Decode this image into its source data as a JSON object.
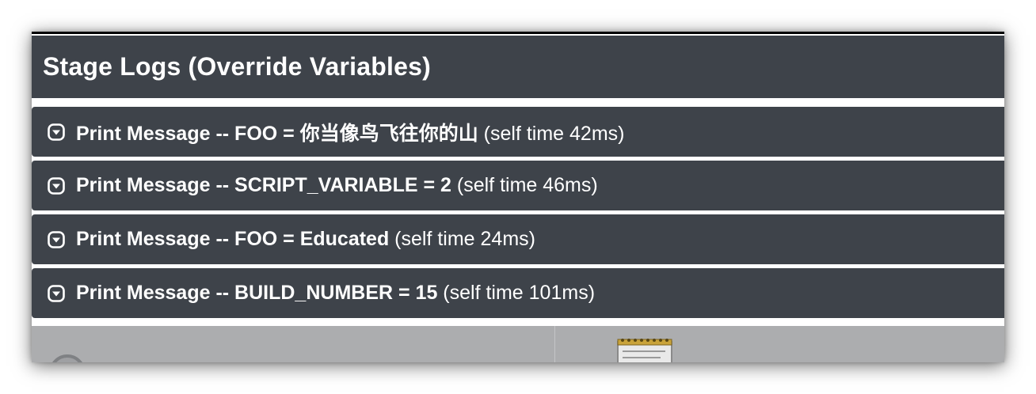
{
  "panel": {
    "title": "Stage Logs (Override Variables)"
  },
  "logs": [
    {
      "label": "Print Message -- FOO = 你当像鸟飞往你的山",
      "time": " (self time 42ms)"
    },
    {
      "label": "Print Message -- SCRIPT_VARIABLE = 2",
      "time": " (self time 46ms)"
    },
    {
      "label": "Print Message -- FOO = Educated",
      "time": " (self time 24ms)"
    },
    {
      "label": "Print Message -- BUILD_NUMBER = 15",
      "time": " (self time 101ms)"
    }
  ],
  "icons": {
    "row_toggle": "expand-toggle-icon",
    "lower_left": "status-icon",
    "lower_right": "notepad-icon"
  },
  "colors": {
    "panel_bg": "#3e434a",
    "text": "#ffffff",
    "lower_bg": "#acadaf"
  }
}
